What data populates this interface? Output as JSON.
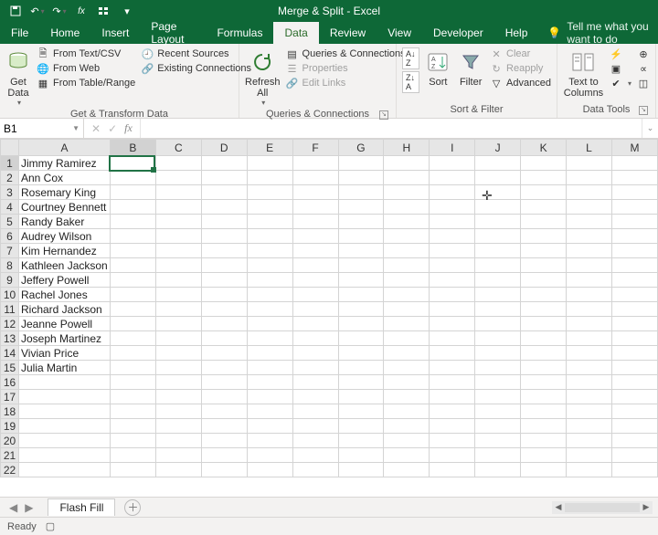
{
  "app": {
    "title": "Merge & Split - Excel"
  },
  "qat": {
    "save": "save-icon",
    "undo": "undo-icon",
    "redo": "redo-icon",
    "fx": "fx",
    "touch": "touch-icon"
  },
  "tabs": {
    "items": [
      "File",
      "Home",
      "Insert",
      "Page Layout",
      "Formulas",
      "Data",
      "Review",
      "View",
      "Developer",
      "Help"
    ],
    "active_index": 5,
    "tell_me": "Tell me what you want to do"
  },
  "ribbon": {
    "get_transform": {
      "label": "Get & Transform Data",
      "get_data": "Get\nData",
      "from_text_csv": "From Text/CSV",
      "from_web": "From Web",
      "from_table_range": "From Table/Range",
      "recent_sources": "Recent Sources",
      "existing_connections": "Existing Connections"
    },
    "queries": {
      "label": "Queries & Connections",
      "refresh_all": "Refresh\nAll",
      "qc": "Queries & Connections",
      "properties": "Properties",
      "edit_links": "Edit Links"
    },
    "sort_filter": {
      "label": "Sort & Filter",
      "sort_az": "A→Z",
      "sort_za": "Z→A",
      "sort": "Sort",
      "filter": "Filter",
      "clear": "Clear",
      "reapply": "Reapply",
      "advanced": "Advanced"
    },
    "data_tools": {
      "label": "Data Tools",
      "text_to_columns": "Text to\nColumns"
    }
  },
  "namebox": {
    "value": "B1"
  },
  "formula_bar": {
    "value": ""
  },
  "columns": [
    "A",
    "B",
    "C",
    "D",
    "E",
    "F",
    "G",
    "H",
    "I",
    "J",
    "K",
    "L",
    "M"
  ],
  "active_col_index": 1,
  "active_row_index": 0,
  "row_count": 22,
  "cells": {
    "A": [
      "Jimmy Ramirez",
      "Ann Cox",
      "Rosemary King",
      "Courtney Bennett",
      "Randy Baker",
      "Audrey Wilson",
      "Kim Hernandez",
      "Kathleen Jackson",
      "Jeffery Powell",
      "Rachel Jones",
      "Richard Jackson",
      "Jeanne Powell",
      "Joseph Martinez",
      "Vivian Price",
      "Julia Martin"
    ]
  },
  "sheet_tabs": {
    "active": "Flash Fill"
  },
  "status": {
    "mode": "Ready"
  },
  "cursor_glyph": "✛"
}
